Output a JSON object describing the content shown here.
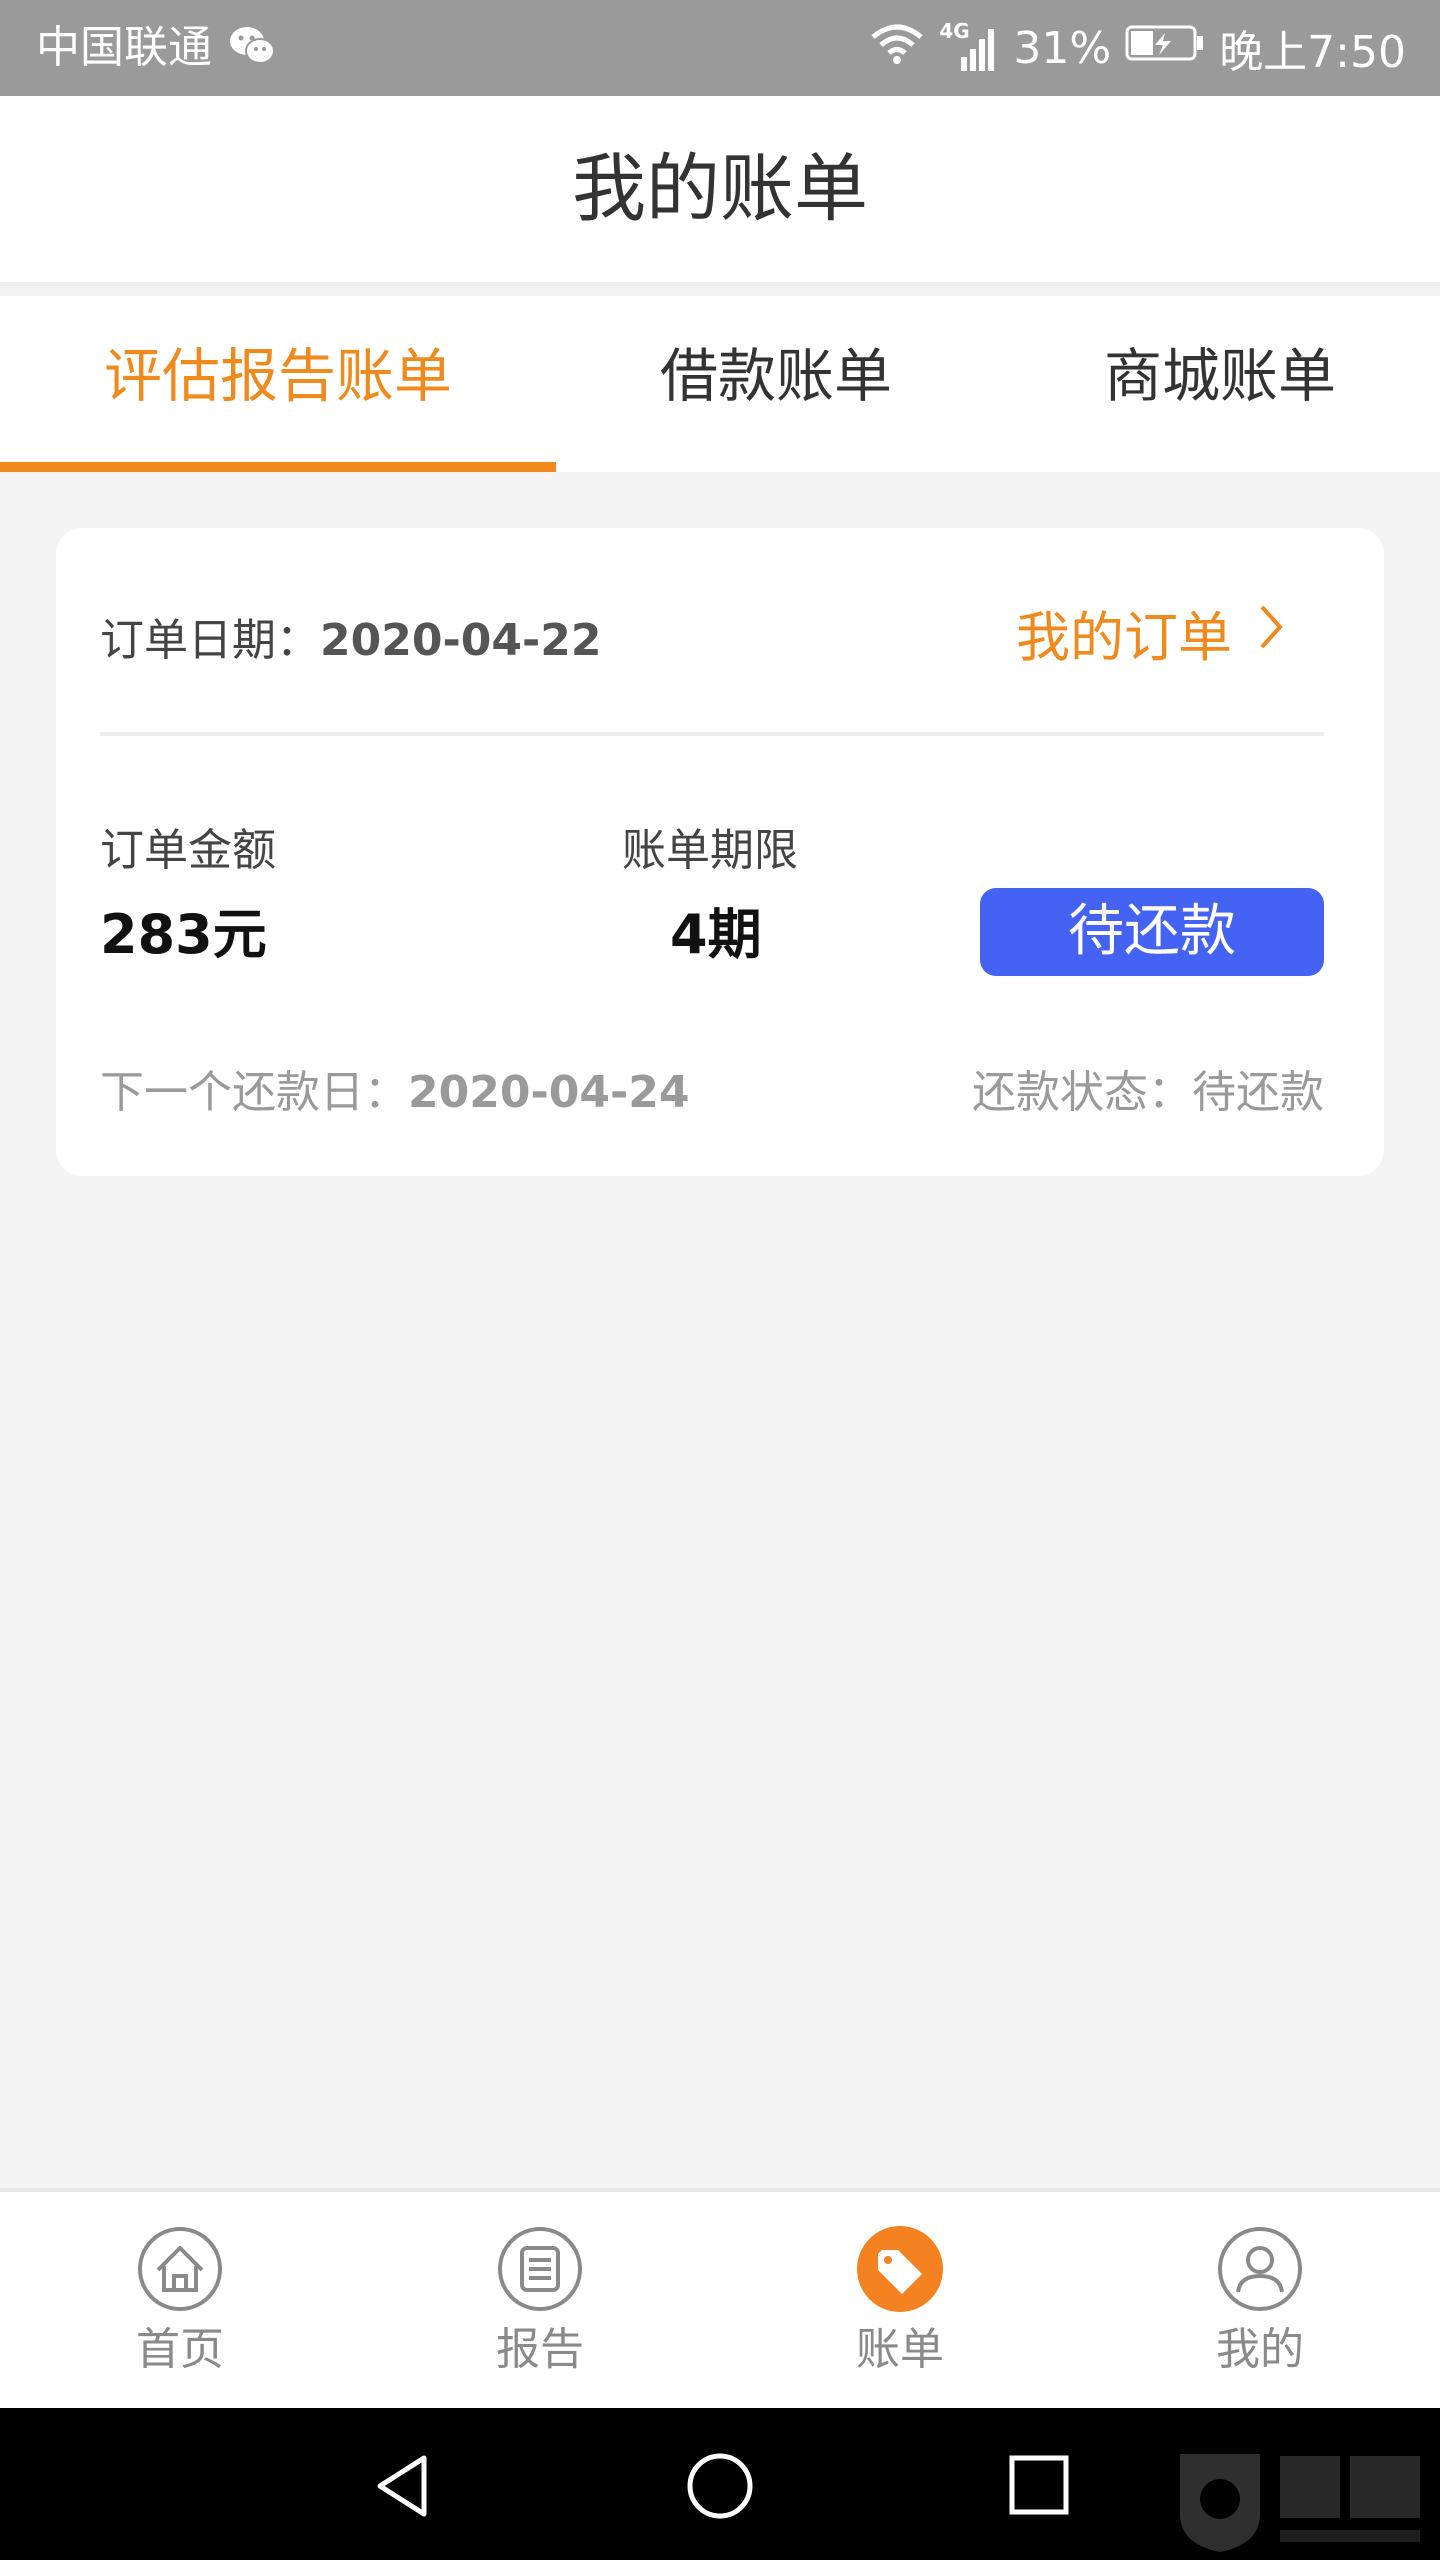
{
  "status_bar": {
    "carrier": "中国联通",
    "network": "4G",
    "battery": "31%",
    "time": "晚上7:50"
  },
  "header": {
    "title": "我的账单"
  },
  "tabs": [
    {
      "label": "评估报告账单",
      "active": true
    },
    {
      "label": "借款账单",
      "active": false
    },
    {
      "label": "商城账单",
      "active": false
    }
  ],
  "bill_card": {
    "order_date_label": "订单日期：",
    "order_date_value": "2020-04-22",
    "my_orders_link": "我的订单",
    "amount_label": "订单金额",
    "amount_value": "283元",
    "term_label": "账单期限",
    "term_value": "4期",
    "pay_button_label": "待还款",
    "next_due_label": "下一个还款日：",
    "next_due_value": "2020-04-24",
    "repay_status_label": "还款状态：",
    "repay_status_value": "待还款"
  },
  "bottom_nav": [
    {
      "label": "首页",
      "icon": "home-icon",
      "active": false
    },
    {
      "label": "报告",
      "icon": "report-icon",
      "active": false
    },
    {
      "label": "账单",
      "icon": "tag-icon",
      "active": true
    },
    {
      "label": "我的",
      "icon": "user-icon",
      "active": false
    }
  ],
  "colors": {
    "accent": "#f08a1c",
    "primary_button": "#4563f2",
    "status_bar": "#9a9a9a",
    "background": "#f4f4f4"
  }
}
